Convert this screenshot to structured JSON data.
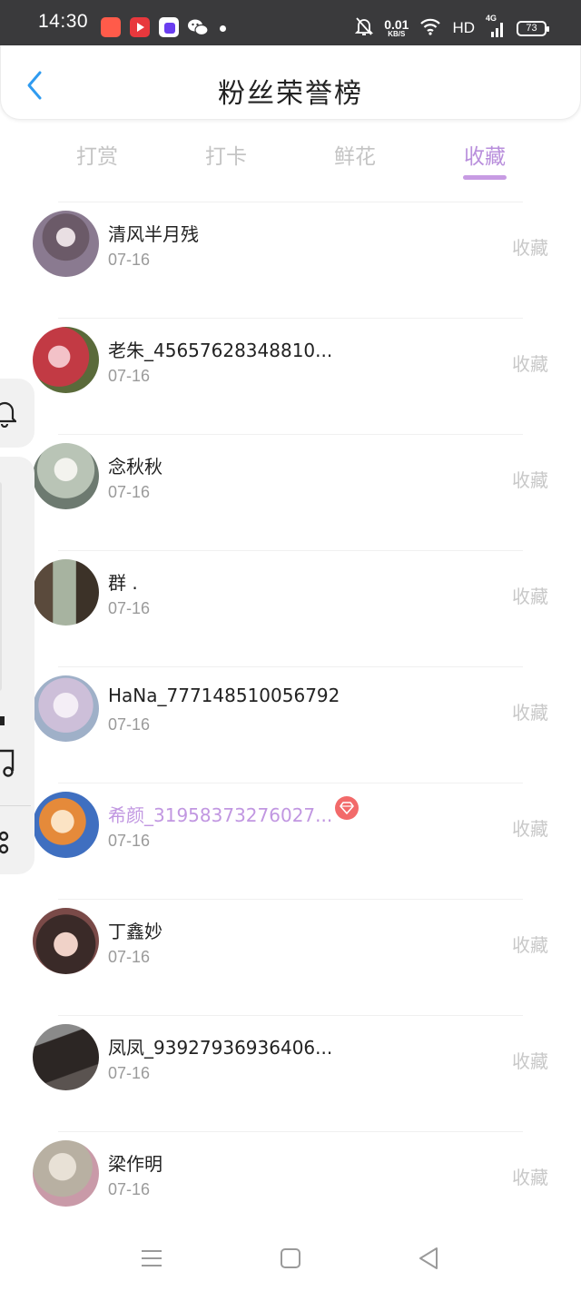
{
  "status_bar": {
    "time": "14:30",
    "net_speed": "0.01",
    "net_unit": "KB/S",
    "hd": "HD",
    "signal": "4G",
    "battery": "73"
  },
  "header": {
    "title": "粉丝荣誉榜"
  },
  "tabs": [
    {
      "label": "打赏",
      "active": false
    },
    {
      "label": "打卡",
      "active": false
    },
    {
      "label": "鲜花",
      "active": false
    },
    {
      "label": "收藏",
      "active": true
    }
  ],
  "fans": [
    {
      "name": "清风半月残",
      "date": "07-16",
      "action": "收藏",
      "vip": false
    },
    {
      "name": "老朱_45657628348810...",
      "date": "07-16",
      "action": "收藏",
      "vip": false
    },
    {
      "name": "念秋秋",
      "date": "07-16",
      "action": "收藏",
      "vip": false
    },
    {
      "name": "群 .",
      "date": "07-16",
      "action": "收藏",
      "vip": false
    },
    {
      "name": "HaNa_777148510056792",
      "date": "07-16",
      "action": "收藏",
      "vip": false
    },
    {
      "name": "希颜_31958373276027...",
      "date": "07-16",
      "action": "收藏",
      "vip": true
    },
    {
      "name": "丁鑫妙",
      "date": "07-16",
      "action": "收藏",
      "vip": false
    },
    {
      "name": "凤凤_93927936936406...",
      "date": "07-16",
      "action": "收藏",
      "vip": false
    },
    {
      "name": "梁作明",
      "date": "07-16",
      "action": "收藏",
      "vip": false
    }
  ],
  "colors": {
    "accent": "#b98fdc",
    "back_arrow": "#2f9bf0",
    "vip_badge": "#f26a6a"
  }
}
